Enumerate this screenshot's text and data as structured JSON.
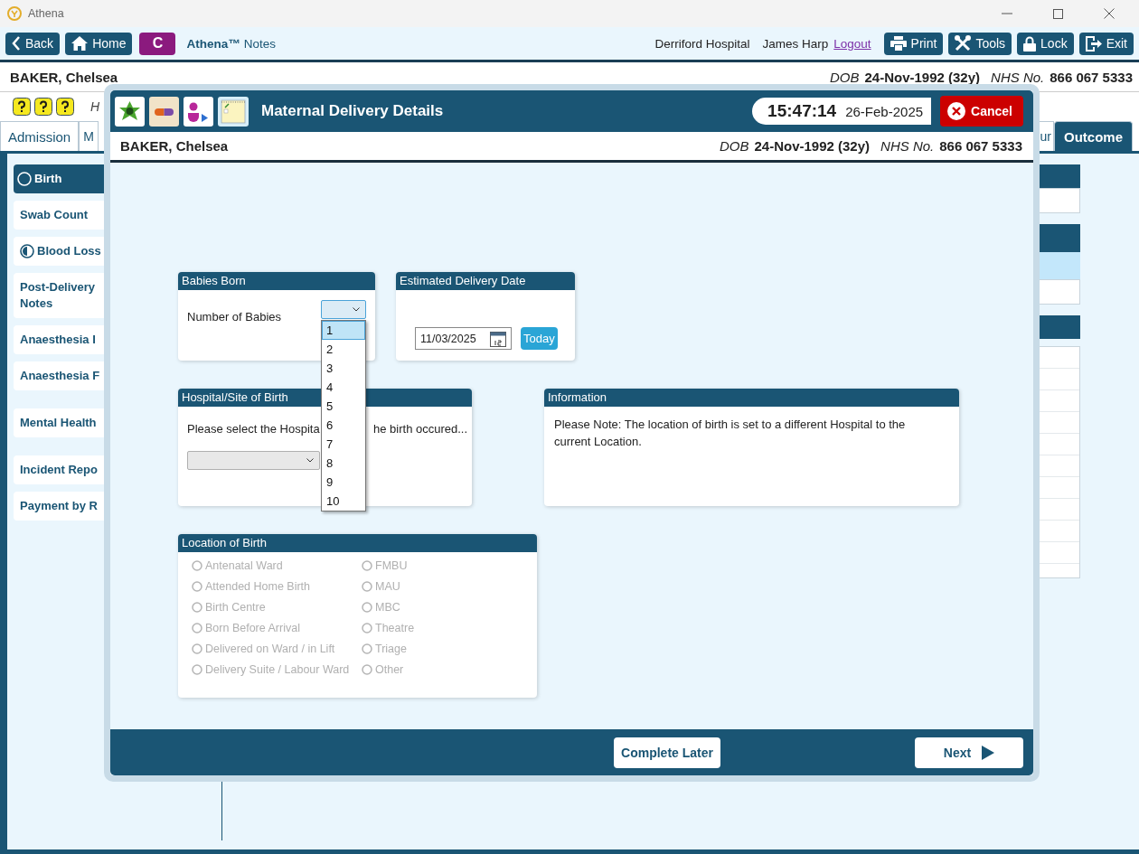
{
  "window": {
    "title": "Athena"
  },
  "toolbar": {
    "left_buttons": [
      {
        "label": "Back",
        "kind": "back"
      },
      {
        "label": "Home",
        "kind": "home"
      }
    ],
    "badge": "C",
    "app_name": "Athena™",
    "app_section": "Notes",
    "hospital": "Derriford Hospital",
    "user": "James Harp",
    "logout": "Logout",
    "right_buttons": [
      {
        "label": "Print",
        "kind": "print"
      },
      {
        "label": "Tools",
        "kind": "tools"
      },
      {
        "label": "Lock",
        "kind": "lock"
      },
      {
        "label": "Exit",
        "kind": "exit"
      }
    ]
  },
  "patient": {
    "name": "BAKER, Chelsea",
    "dob_label": "DOB",
    "dob": "24-Nov-1992 (32y)",
    "nhs_label": "NHS No.",
    "nhs": "866 067 5333"
  },
  "help_bar": {
    "text": "H"
  },
  "tabs": [
    {
      "label": "Admission",
      "selected": false
    },
    {
      "label": "M",
      "selected": false
    },
    {
      "label": "ur",
      "selected": false
    },
    {
      "label": "Outcome",
      "selected": true
    }
  ],
  "sidebar": {
    "groups": [
      {
        "items": [
          {
            "label": "Birth",
            "kind": "empty",
            "selected": true
          },
          {
            "label": "Swab Count",
            "kind": "plain",
            "selected": false
          },
          {
            "label": "Blood Loss",
            "kind": "half",
            "selected": false
          },
          {
            "label": "Post-Delivery Notes",
            "kind": "plain",
            "selected": false
          },
          {
            "label": "Anaesthesia I",
            "kind": "plain",
            "selected": false
          },
          {
            "label": "Anaesthesia F",
            "kind": "plain",
            "selected": false
          }
        ]
      },
      {
        "items": [
          {
            "label": "Mental Health",
            "kind": "plain",
            "selected": false
          }
        ]
      },
      {
        "items": [
          {
            "label": "Incident Repo",
            "kind": "plain",
            "selected": false
          },
          {
            "label": "Payment by R",
            "kind": "plain",
            "selected": false
          }
        ]
      }
    ]
  },
  "modal": {
    "title": "Maternal Delivery Details",
    "time": "15:47:14",
    "date": "26-Feb-2025",
    "cancel": "Cancel",
    "patient": {
      "name": "BAKER, Chelsea",
      "dob_label": "DOB",
      "dob": "24-Nov-1992 (32y)",
      "nhs_label": "NHS No.",
      "nhs": "866 067 5333"
    },
    "babies_born": {
      "title": "Babies Born",
      "label": "Number of Babies",
      "expanded": true,
      "options": [
        {
          "label": "1",
          "selected": true
        },
        {
          "label": "2",
          "selected": false
        },
        {
          "label": "3",
          "selected": false
        },
        {
          "label": "4",
          "selected": false
        },
        {
          "label": "5",
          "selected": false
        },
        {
          "label": "6",
          "selected": false
        },
        {
          "label": "7",
          "selected": false
        },
        {
          "label": "8",
          "selected": false
        },
        {
          "label": "9",
          "selected": false
        },
        {
          "label": "10",
          "selected": false
        }
      ]
    },
    "delivery_date": {
      "title": "Estimated Delivery Date",
      "value": "11/03/2025",
      "today": "Today"
    },
    "hospital_site": {
      "title": "Hospital/Site of Birth",
      "prompt_start": "Please select the Hospita",
      "prompt_end": "he birth occured..."
    },
    "information": {
      "title": "Information",
      "text": "Please Note: The location of birth is set to a different Hospital to the current Location."
    },
    "location": {
      "title": "Location of Birth",
      "options": [
        {
          "label": "Antenatal Ward",
          "selected": false,
          "disabled": true
        },
        {
          "label": "Attended Home Birth",
          "selected": false,
          "disabled": true
        },
        {
          "label": "Birth Centre",
          "selected": false,
          "disabled": true
        },
        {
          "label": "Born Before Arrival",
          "selected": false,
          "disabled": true
        },
        {
          "label": "Delivered on Ward / in Lift",
          "selected": false,
          "disabled": true
        },
        {
          "label": "Delivery Suite / Labour Ward",
          "selected": false,
          "disabled": true
        },
        {
          "label": "FMBU",
          "selected": false,
          "disabled": true
        },
        {
          "label": "MAU",
          "selected": false,
          "disabled": true
        },
        {
          "label": "MBC",
          "selected": false,
          "disabled": true
        },
        {
          "label": "Theatre",
          "selected": false,
          "disabled": true
        },
        {
          "label": "Triage",
          "selected": false,
          "disabled": true
        },
        {
          "label": "Other",
          "selected": false,
          "disabled": true
        }
      ]
    },
    "footer": {
      "complete_later": "Complete Later",
      "next": "Next"
    }
  }
}
